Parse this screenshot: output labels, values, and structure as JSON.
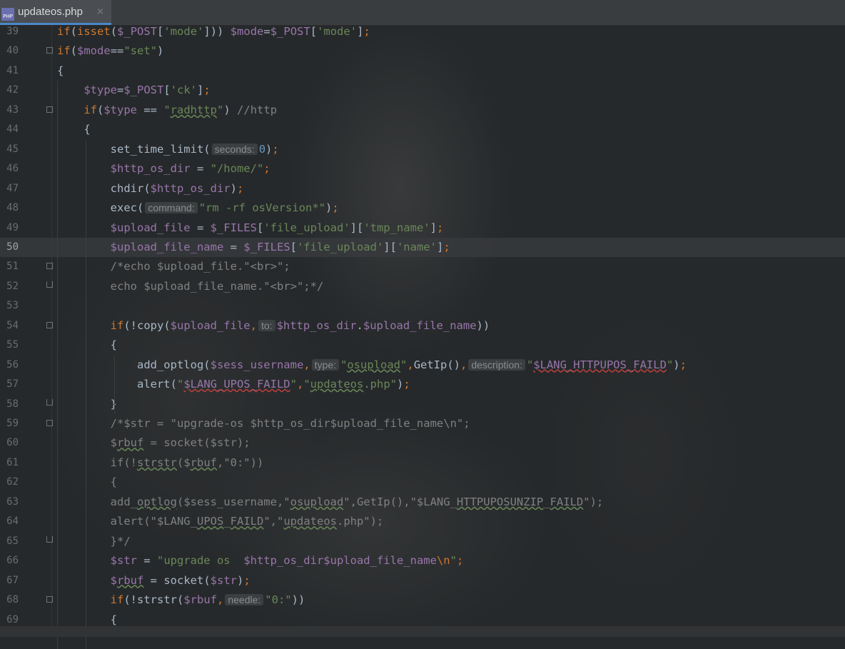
{
  "tab": {
    "icon": "php-file-icon",
    "icon_text": "PHP",
    "label": "updateos.php",
    "close": "×"
  },
  "current_line": "50",
  "lines": [
    {
      "n": "39",
      "html": "<span class='kw'>if</span><span class='plain'>(</span><span class='kw'>isset</span><span class='plain'>(</span><span class='var'>$_POST</span><span class='plain'>[</span><span class='str'>'mode'</span><span class='plain'>])) </span><span class='var'>$mode</span><span class='plain'>=</span><span class='var'>$_POST</span><span class='plain'>[</span><span class='str'>'mode'</span><span class='plain'>]</span><span class='kw'>;</span>"
    },
    {
      "n": "40",
      "html": "<span class='kw'>if</span><span class='plain'>(</span><span class='var'>$mode</span><span class='plain'>==</span><span class='str'>\"set\"</span><span class='plain'>)</span>"
    },
    {
      "n": "41",
      "html": "<span class='plain'>{</span>"
    },
    {
      "n": "42",
      "html": "    <span class='var'>$type</span><span class='plain'>=</span><span class='var'>$_POST</span><span class='plain'>[</span><span class='str'>'ck'</span><span class='plain'>]</span><span class='kw'>;</span>"
    },
    {
      "n": "43",
      "html": "    <span class='kw'>if</span><span class='plain'>(</span><span class='var'>$type</span><span class='plain'> == </span><span class='str'>\"<span class='ul'>radhttp</span>\"</span><span class='plain'>) </span><span class='cm'>//http</span>"
    },
    {
      "n": "44",
      "html": "    <span class='plain'>{</span>"
    },
    {
      "n": "45",
      "html": "        <span class='plain'>set_time_limit(</span><span class='hint'>seconds:</span><span class='num'>0</span><span class='plain'>)</span><span class='kw'>;</span>"
    },
    {
      "n": "46",
      "html": "        <span class='var'>$http_os_dir</span><span class='plain'> = </span><span class='str'>\"/home/\"</span><span class='kw'>;</span>"
    },
    {
      "n": "47",
      "html": "        <span class='plain'>chdir(</span><span class='var'>$http_os_dir</span><span class='plain'>)</span><span class='kw'>;</span>"
    },
    {
      "n": "48",
      "html": "        <span class='plain'>exec(</span><span class='hint'>command:</span><span class='str'>\"rm -rf osVersion*\"</span><span class='plain'>)</span><span class='kw'>;</span>"
    },
    {
      "n": "49",
      "html": "        <span class='var'>$upload_file</span><span class='plain'> = </span><span class='var'>$_FILES</span><span class='plain'>[</span><span class='str'>'file_upload'</span><span class='plain'>][</span><span class='str'>'tmp_name'</span><span class='plain'>]</span><span class='kw'>;</span>"
    },
    {
      "n": "50",
      "html": "        <span class='var'>$upload_file_name</span><span class='plain'> = </span><span class='var'>$_FILES</span><span class='plain'>[</span><span class='str'>'file_upload'</span><span class='plain'>][</span><span class='str'>'name'</span><span class='plain'>]</span><span class='kw'>;</span>"
    },
    {
      "n": "51",
      "html": "        <span class='cm'>/*echo $upload_file.\"&lt;br&gt;\";</span>"
    },
    {
      "n": "52",
      "html": "        <span class='cm'>echo $upload_file_name.\"&lt;br&gt;\";*/</span>"
    },
    {
      "n": "53",
      "html": ""
    },
    {
      "n": "54",
      "html": "        <span class='kw'>if</span><span class='plain'>(!copy(</span><span class='var'>$upload_file</span><span class='kw'>,</span><span class='hint'>to:</span><span class='var'>$http_os_dir</span><span class='plain'>.</span><span class='var'>$upload_file_name</span><span class='plain'>))</span>"
    },
    {
      "n": "55",
      "html": "        <span class='plain'>{</span>"
    },
    {
      "n": "56",
      "html": "            <span class='plain'>add_optlog(</span><span class='var'>$sess_username</span><span class='kw'>,</span><span class='hint'>type:</span><span class='str'>\"<span class='ul'>osupload</span>\"</span><span class='kw'>,</span><span class='plain'>GetIp()</span><span class='kw'>,</span><span class='hint'>description:</span><span class='str'>\"<span class='var ulr'>$LANG_HTTPUPOS_FAILD</span>\"</span><span class='plain'>)</span><span class='kw'>;</span>"
    },
    {
      "n": "57",
      "html": "            <span class='plain'>alert(</span><span class='str'>\"<span class='var ulr'>$LANG_UPOS_FAILD</span>\"</span><span class='kw'>,</span><span class='str'>\"<span class='ul'>updateos</span>.php\"</span><span class='plain'>)</span><span class='kw'>;</span>"
    },
    {
      "n": "58",
      "html": "        <span class='plain'>}</span>"
    },
    {
      "n": "59",
      "html": "        <span class='cm'>/*$str = \"upgrade-os $http_os_dir$upload_file_name\\n\";</span>"
    },
    {
      "n": "60",
      "html": "        <span class='cm'>$<span class='ul'>rbuf</span> = socket($str);</span>"
    },
    {
      "n": "61",
      "html": "        <span class='cm'>if(!<span class='ul'>strstr</span>($<span class='ul'>rbuf</span>,\"0:\"))</span>"
    },
    {
      "n": "62",
      "html": "        <span class='cm'>{</span>"
    },
    {
      "n": "63",
      "html": "        <span class='cm'>add_<span class='ul'>optlog</span>($sess_username,\"<span class='ul'>osupload</span>\",GetIp(),\"$LANG_<span class='ul'>HTTPUPOSUNZIP</span>_<span class='ul'>FAILD</span>\");</span>"
    },
    {
      "n": "64",
      "html": "        <span class='cm'>alert(\"$LANG_<span class='ul'>UPOS</span>_<span class='ul'>FAILD</span>\",\"<span class='ul'>updateos</span>.php\");</span>"
    },
    {
      "n": "65",
      "html": "        <span class='cm'>}*/</span>"
    },
    {
      "n": "66",
      "html": "        <span class='var'>$str</span><span class='plain'> = </span><span class='str'>\"upgrade os  <span class='var'>$http_os_dir$upload_file_name</span><span class='kw'>\\n</span>\"</span><span class='kw'>;</span>"
    },
    {
      "n": "67",
      "html": "        <span class='var'>$<span class='ul'>rbuf</span></span><span class='plain'> = socket(</span><span class='var'>$str</span><span class='plain'>)</span><span class='kw'>;</span>"
    },
    {
      "n": "68",
      "html": "        <span class='kw'>if</span><span class='plain'>(!strstr(</span><span class='var'>$rbuf</span><span class='kw'>,</span><span class='hint'>needle:</span><span class='str'>\"0:\"</span><span class='plain'>))</span>"
    },
    {
      "n": "69",
      "html": "        <span class='plain'>{</span>"
    }
  ],
  "folds": {
    "40": "down",
    "43": "down",
    "51": "down",
    "52": "up",
    "54": "down",
    "58": "up",
    "59": "down",
    "65": "up",
    "68": "down"
  },
  "colors": {
    "keyword": "#cc7832",
    "variable": "#9876aa",
    "string": "#6a8759",
    "comment": "#808080",
    "number": "#6897bb",
    "text": "#a9b7c6"
  }
}
